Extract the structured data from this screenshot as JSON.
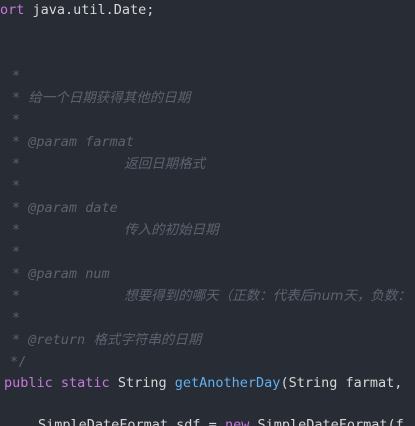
{
  "code": {
    "line_import": {
      "keyword_fragment": "ort",
      "rest": " java.util.Date;"
    },
    "doc": {
      "star": "*",
      "close": "*/",
      "summary": "给一个日期获得其他的日期",
      "param1_tag": "@param",
      "param1_name": "farmat",
      "param1_desc": "返回日期格式",
      "param2_tag": "@param",
      "param2_name": "date",
      "param2_desc": "传入的初始日期",
      "param3_tag": "@param",
      "param3_name": "num",
      "param3_desc": "想要得到的哪天（正数：代表后num天，负数：",
      "return_tag": "@return",
      "return_desc": "格式字符串的日期"
    },
    "signature": {
      "mod1": "public",
      "mod2": "static",
      "return_type": "String",
      "method": "getAnotherDay",
      "params": "(String farmat,"
    },
    "last_line": {
      "type": "SimpleDateFormat",
      "var": " sdf = ",
      "kw_new": "new",
      "ctor": " SimpleDateFormat(f"
    }
  }
}
